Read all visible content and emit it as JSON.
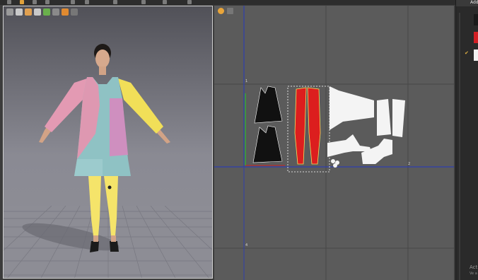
{
  "right_panel": {
    "add_label": "Add",
    "swatches": [
      "#1a1a1a",
      "#d21f24",
      "#f2f2f2"
    ],
    "activation_line1": "Act",
    "activation_line2": "Ve a"
  },
  "viewport_2d": {
    "axis_markers": [
      "1",
      "2",
      "4"
    ]
  },
  "colors": {
    "pattern_black": "#111111",
    "pattern_red": "#dc1e1e",
    "pattern_white": "#f4f4f4",
    "grid_line": "#3f3f3f",
    "axis_blue": "#2f3fae",
    "axis_green": "#3aa33a"
  }
}
